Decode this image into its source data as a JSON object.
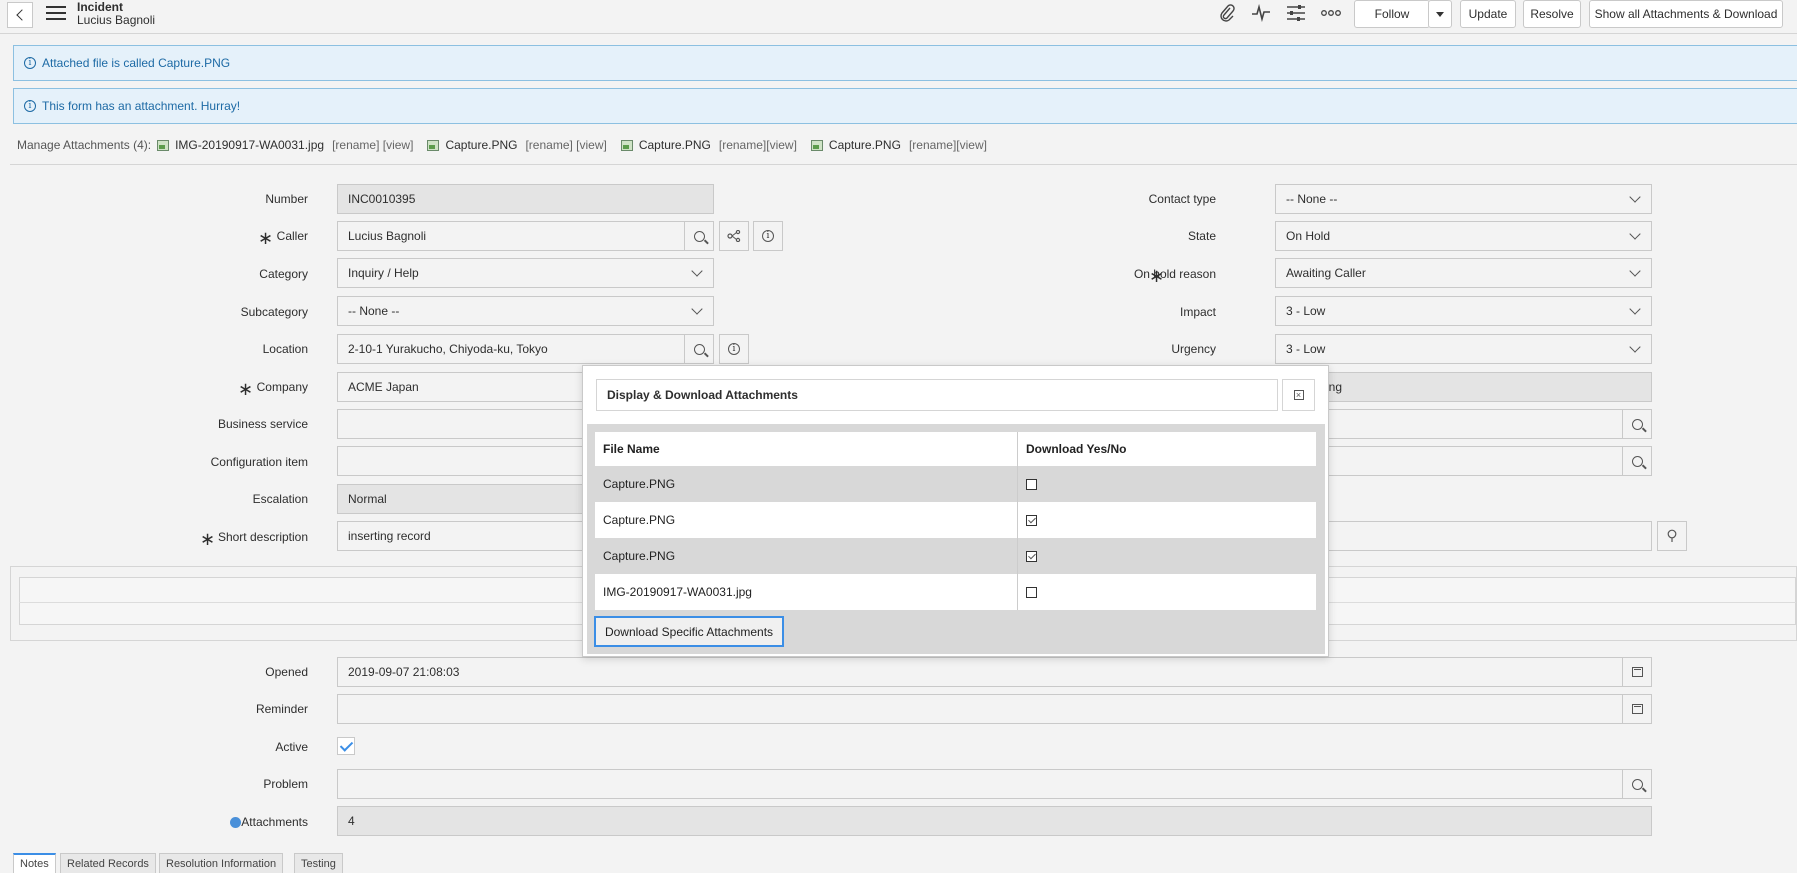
{
  "header": {
    "title": "Incident",
    "subtitle": "Lucius Bagnoli",
    "follow_label": "Follow",
    "update_label": "Update",
    "resolve_label": "Resolve",
    "show_all_label": "Show all Attachments & Download"
  },
  "messages": [
    "Attached file is called Capture.PNG",
    "This form has an attachment. Hurray!"
  ],
  "attachments": {
    "label": "Manage Attachments (4):",
    "items": [
      {
        "name": "IMG-20190917-WA0031.jpg",
        "actions": "[rename] [view]"
      },
      {
        "name": "Capture.PNG",
        "actions": "[rename] [view]"
      },
      {
        "name": "Capture.PNG",
        "actions": "[rename][view]"
      },
      {
        "name": "Capture.PNG",
        "actions": "[rename][view]"
      }
    ]
  },
  "form": {
    "number_label": "Number",
    "number": "INC0010395",
    "caller_label": "Caller",
    "caller": "Lucius Bagnoli",
    "category_label": "Category",
    "category": "Inquiry / Help",
    "subcategory_label": "Subcategory",
    "subcategory": "-- None --",
    "location_label": "Location",
    "location": "2-10-1 Yurakucho, Chiyoda-ku, Tokyo",
    "company_label": "Company",
    "company": "ACME Japan",
    "business_service_label": "Business service",
    "configuration_item_label": "Configuration item",
    "escalation_label": "Escalation",
    "escalation": "Normal",
    "short_description_label": "Short description",
    "short_description": "inserting record",
    "contact_type_label": "Contact type",
    "contact_type": "-- None --",
    "state_label": "State",
    "state": "On Hold",
    "on_hold_reason_label": "On hold reason",
    "on_hold_reason": "Awaiting Caller",
    "impact_label": "Impact",
    "impact": "3 - Low",
    "urgency_label": "Urgency",
    "urgency": "3 - Low",
    "priority_partial": "ing",
    "opened_label": "Opened",
    "opened": "2019-09-07 21:08:03",
    "reminder_label": "Reminder",
    "active_label": "Active",
    "problem_label": "Problem",
    "attachments_label": "Attachments",
    "attachments_count": "4"
  },
  "modal": {
    "title": "Display & Download Attachments",
    "col_file": "File Name",
    "col_download": "Download Yes/No",
    "rows": [
      {
        "file": "Capture.PNG",
        "checked": false
      },
      {
        "file": "Capture.PNG",
        "checked": true
      },
      {
        "file": "Capture.PNG",
        "checked": true
      },
      {
        "file": "IMG-20190917-WA0031.jpg",
        "checked": false
      }
    ],
    "download_label": "Download Specific Attachments"
  },
  "tabs": [
    "Notes",
    "Related Records",
    "Resolution Information",
    "Testing"
  ],
  "colors": {
    "accent": "#3b8ee6",
    "info_bg": "#e5f1fa",
    "info_text": "#1d6aa5"
  }
}
